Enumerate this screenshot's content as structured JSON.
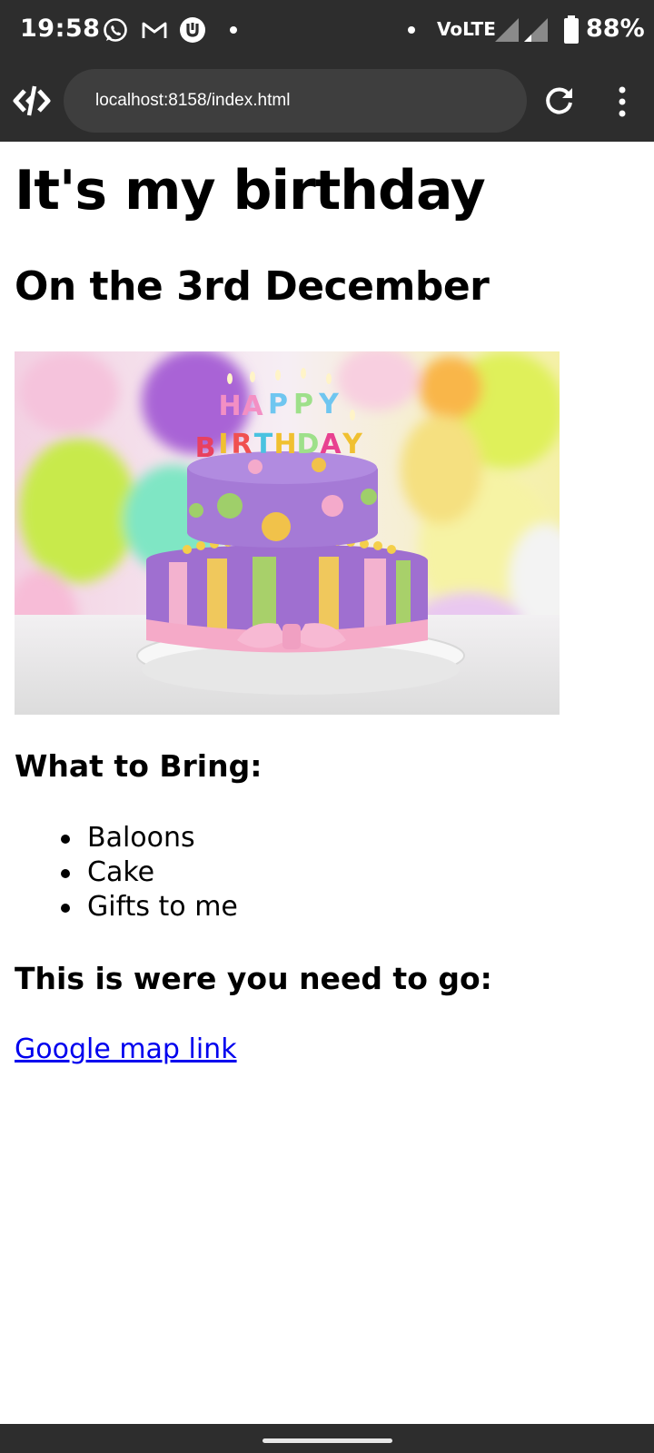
{
  "status_bar": {
    "time": "19:58",
    "network": "VoLTE",
    "battery": "88%",
    "icons": [
      "whatsapp-icon",
      "gmail-icon",
      "app-u-icon",
      "signal-icon",
      "battery-icon"
    ]
  },
  "browser": {
    "url": "localhost:8158/index.html",
    "icons": [
      "browser-logo-icon",
      "reload-icon",
      "overflow-menu-icon"
    ]
  },
  "page": {
    "title": "It's my birthday",
    "subtitle": "On the 3rd December",
    "image_alt": "birthday-cake-image",
    "bring_heading": "What to Bring:",
    "bring_items": [
      "Baloons",
      "Cake",
      "Gifts to me"
    ],
    "directions_heading": "This is were you need to go:",
    "map_link": "Google map link"
  },
  "colors": {
    "bar": "#2d2d2d",
    "url_pill": "#3e3e3e",
    "link": "#0000ee"
  }
}
